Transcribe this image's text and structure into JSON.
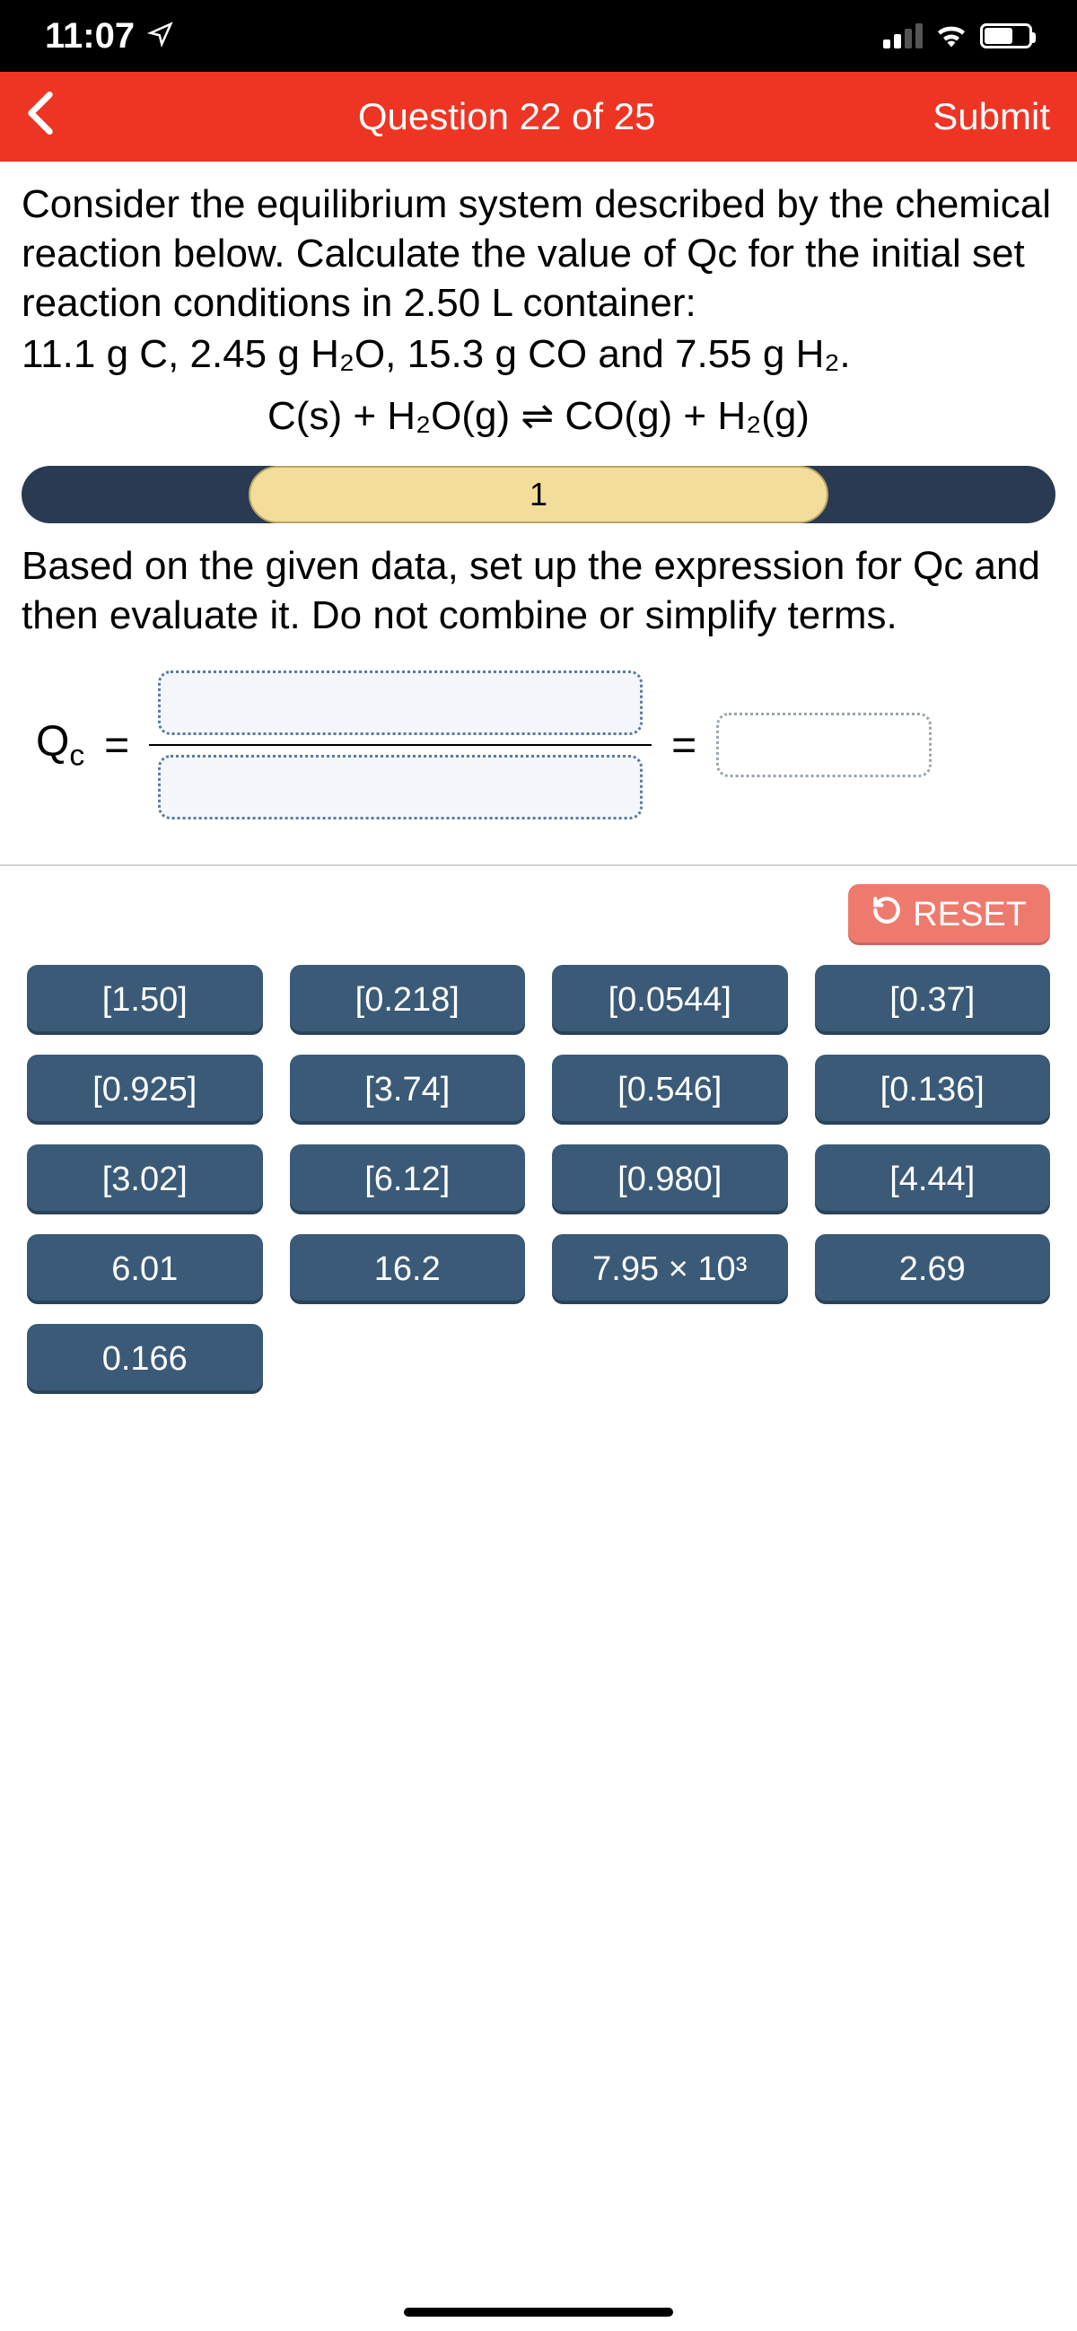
{
  "status": {
    "time": "11:07",
    "location_icon": "location-arrow"
  },
  "header": {
    "title": "Question 22 of 25",
    "submit": "Submit"
  },
  "question": {
    "prompt_line1": "Consider the equilibrium system described by the chemical reaction below. Calculate the value of Qc for the initial set reaction conditions in 2.50 L container:",
    "prompt_line2": "11.1 g C, 2.45 g H₂O, 15.3 g CO and 7.55 g H₂.",
    "equation": "C(s) + H₂O(g) ⇌ CO(g) + H₂(g)",
    "step_current": "1",
    "instruction": "Based on the given data, set up the expression for Qc and then evaluate it. Do not combine or simplify terms.",
    "qc_label_main": "Q",
    "qc_label_sub": "c",
    "equals": "="
  },
  "controls": {
    "reset": "RESET"
  },
  "tiles": [
    "[1.50]",
    "[0.218]",
    "[0.0544]",
    "[0.37]",
    "[0.925]",
    "[3.74]",
    "[0.546]",
    "[0.136]",
    "[3.02]",
    "[6.12]",
    "[0.980]",
    "[4.44]",
    "6.01",
    "16.2",
    "7.95 × 10³",
    "2.69",
    "0.166"
  ]
}
